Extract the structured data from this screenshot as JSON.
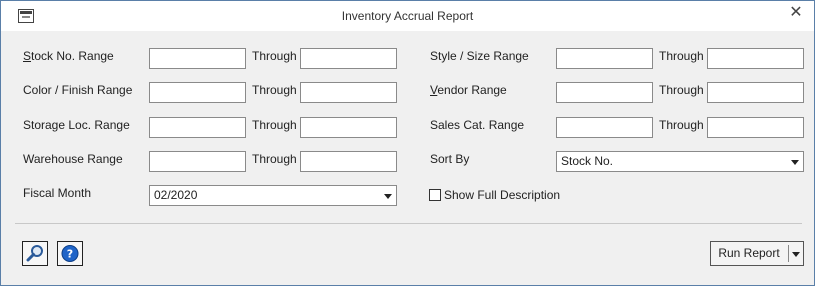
{
  "window": {
    "title": "Inventory Accrual Report",
    "close_glyph": "✕",
    "icon": "report-window-icon"
  },
  "left": {
    "stock": {
      "label_pre": "",
      "label_u": "S",
      "label_post": "tock No. Range",
      "from": "",
      "through_label": "Through",
      "to": ""
    },
    "color": {
      "label": "Color / Finish Range",
      "from": "",
      "through_label": "Through",
      "to": ""
    },
    "storage": {
      "label": "Storage Loc. Range",
      "from": "",
      "through_label": "Through",
      "to": ""
    },
    "warehouse": {
      "label": "Warehouse Range",
      "from": "",
      "through_label": "Through",
      "to": ""
    },
    "fiscal_month": {
      "label": "Fiscal Month",
      "value": "02/2020"
    }
  },
  "right": {
    "style": {
      "label": "Style / Size Range",
      "from": "",
      "through_label": "Through",
      "to": ""
    },
    "vendor": {
      "label_u": "V",
      "label_post": "endor Range",
      "from": "",
      "through_label": "Through",
      "to": ""
    },
    "sales": {
      "label": "Sales Cat. Range",
      "from": "",
      "through_label": "Through",
      "to": ""
    },
    "sort_by": {
      "label": "Sort By",
      "value": "Stock No."
    },
    "show_full_description": {
      "label": "Show Full Description",
      "checked": false
    }
  },
  "footer": {
    "search_icon": "magnifier-icon",
    "help_icon": "help-icon",
    "run_label": "Run Report"
  }
}
